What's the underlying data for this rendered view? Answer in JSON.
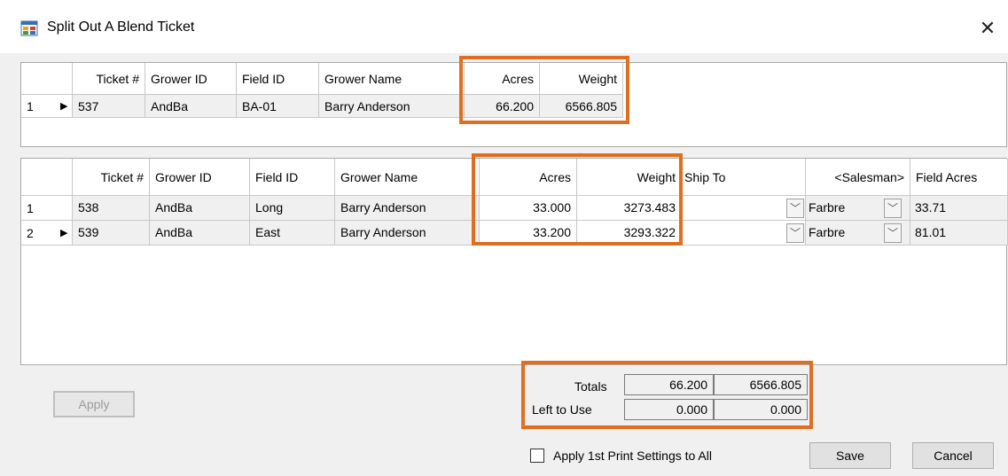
{
  "window": {
    "title": "Split Out A Blend Ticket",
    "close_glyph": "✕"
  },
  "top_grid": {
    "columns": [
      "Ticket #",
      "Grower ID",
      "Field ID",
      "Grower Name",
      "Acres",
      "Weight"
    ],
    "rows": [
      {
        "row_num": "1",
        "ticket": "537",
        "grower_id": "AndBa",
        "field_id": "BA-01",
        "grower_name": "Barry Anderson",
        "acres": "66.200",
        "weight": "6566.805"
      }
    ]
  },
  "split_grid": {
    "columns": [
      "Ticket #",
      "Grower ID",
      "Field ID",
      "Grower Name",
      "Acres",
      "Weight",
      "Ship To",
      "<Salesman>",
      "Field Acres"
    ],
    "rows": [
      {
        "row_num": "1",
        "ticket": "538",
        "grower_id": "AndBa",
        "field_id": "Long",
        "grower_name": "Barry Anderson",
        "acres": "33.000",
        "weight": "3273.483",
        "ship_to": "",
        "salesman": "Farbre",
        "field_acres": "33.71"
      },
      {
        "row_num": "2",
        "ticket": "539",
        "grower_id": "AndBa",
        "field_id": "East",
        "grower_name": "Barry Anderson",
        "acres": "33.200",
        "weight": "3293.322",
        "ship_to": "",
        "salesman": "Farbre",
        "field_acres": "81.01"
      }
    ]
  },
  "totals": {
    "totals_label": "Totals",
    "left_label": "Left to Use",
    "total_acres": "66.200",
    "total_weight": "6566.805",
    "left_acres": "0.000",
    "left_weight": "0.000"
  },
  "buttons": {
    "apply": "Apply",
    "save": "Save",
    "cancel": "Cancel"
  },
  "options": {
    "apply_print_label": "Apply 1st Print Settings to All",
    "apply_print_checked": false
  },
  "colors": {
    "highlight": "#e06e21"
  }
}
